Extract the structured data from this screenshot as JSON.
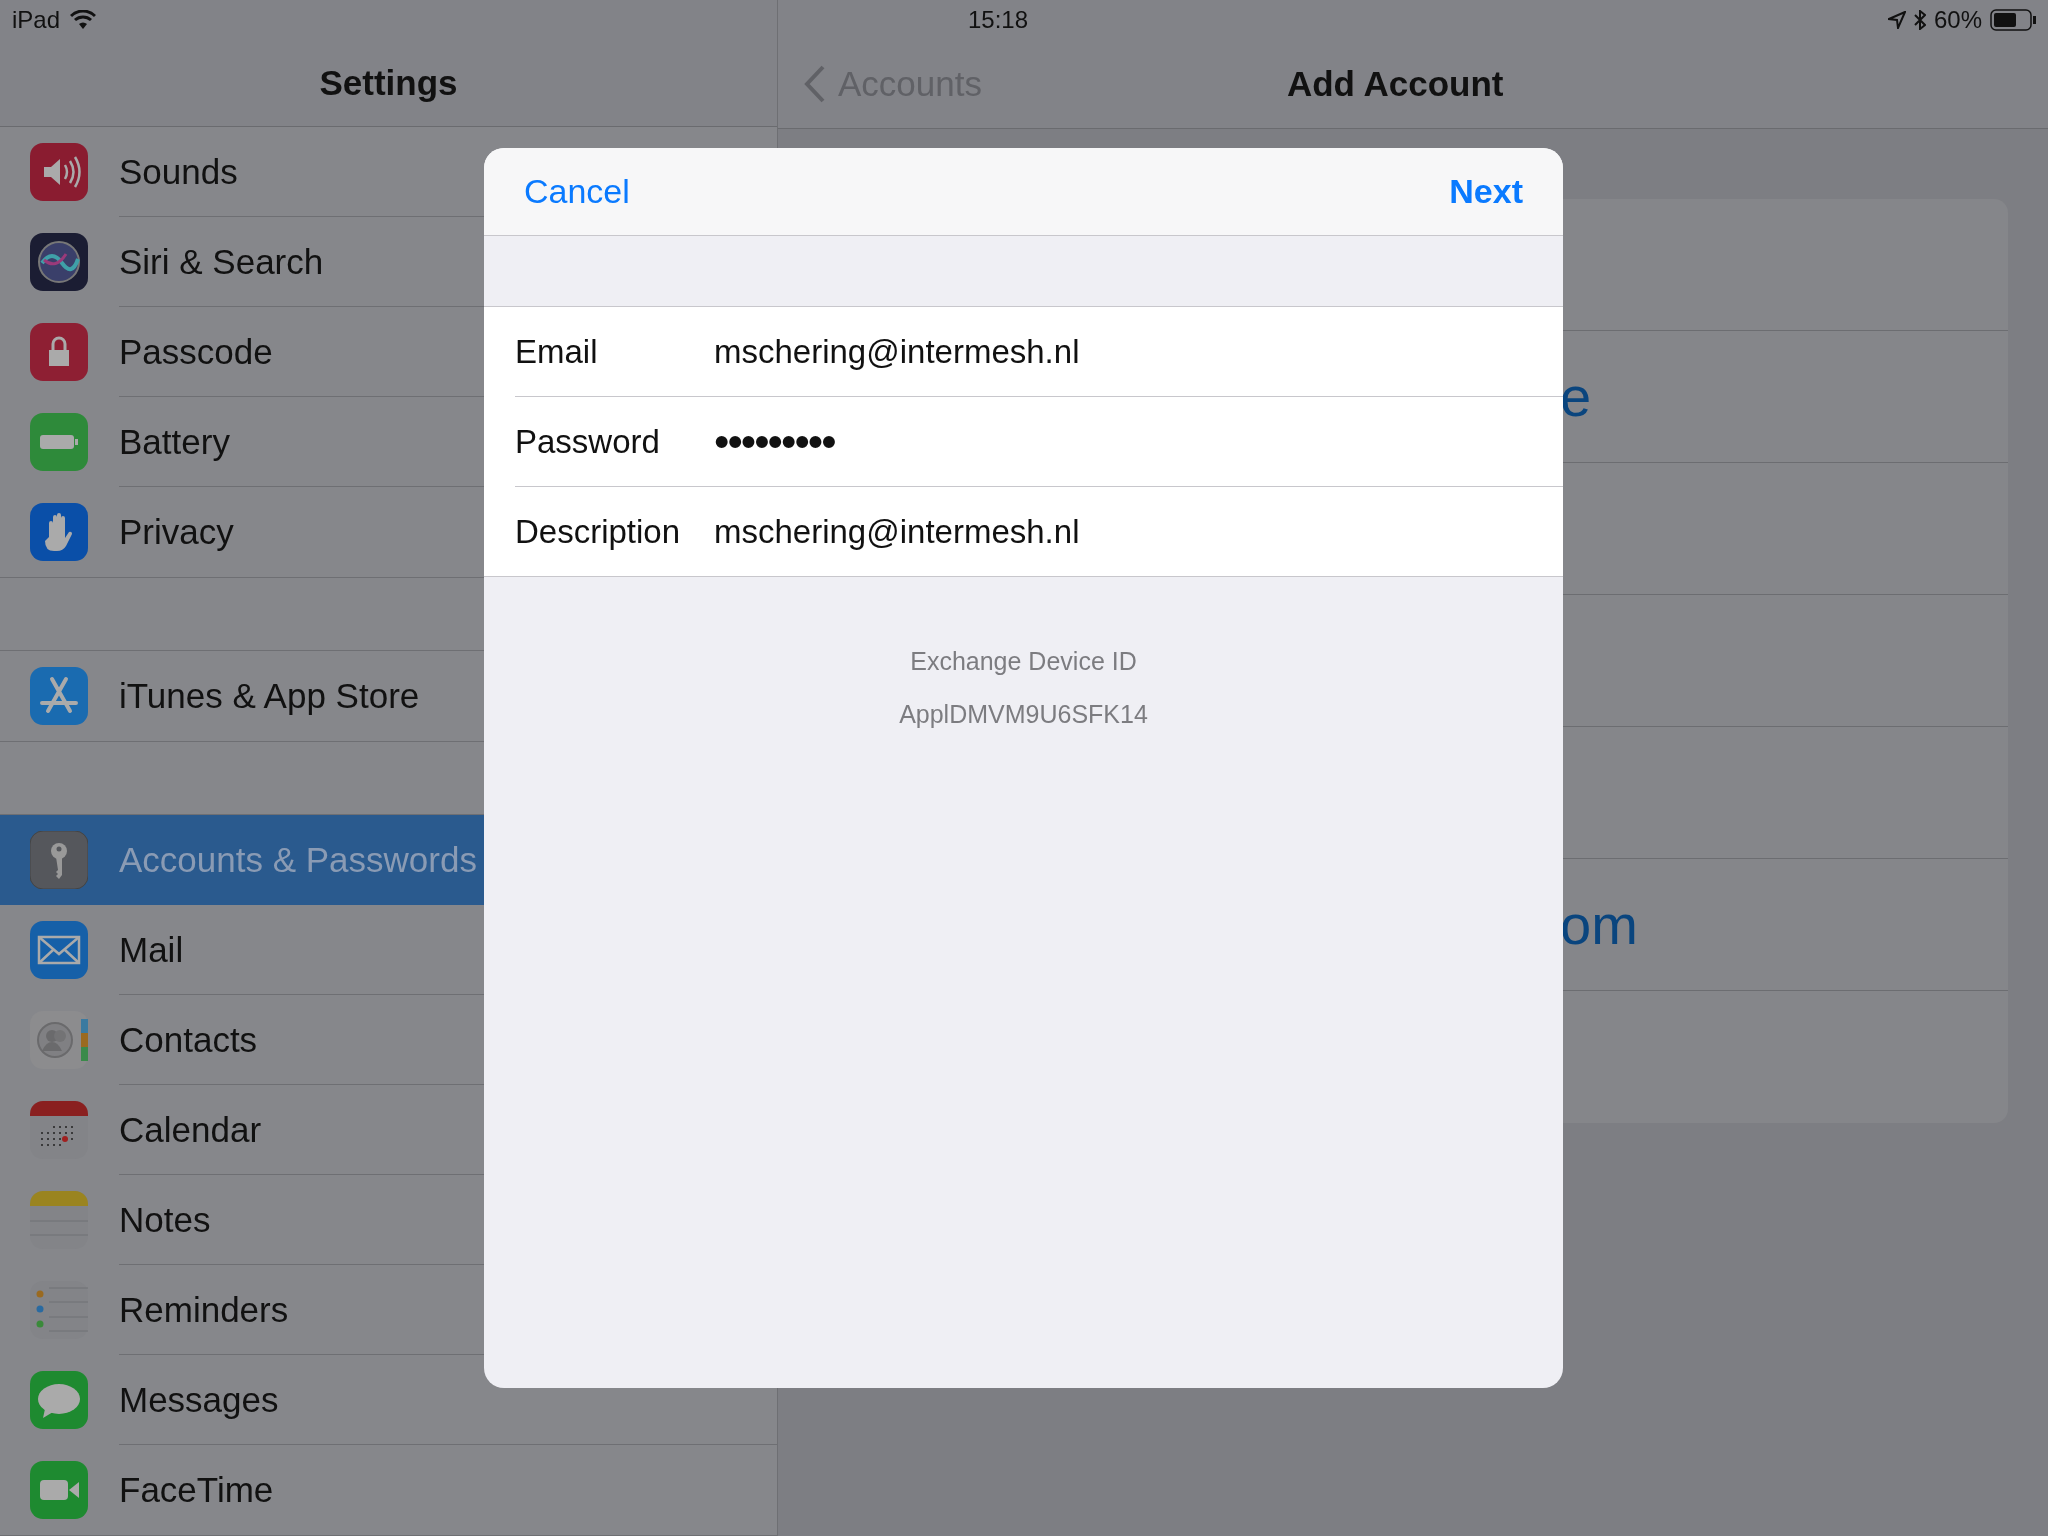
{
  "status_bar": {
    "device": "iPad",
    "time": "15:18",
    "battery_percent": "60%"
  },
  "sidebar": {
    "title": "Settings",
    "groups": [
      [
        {
          "label": "Sounds",
          "kind": "sounds",
          "selected": false
        },
        {
          "label": "Siri & Search",
          "kind": "siri",
          "selected": false
        },
        {
          "label": "Passcode",
          "kind": "passcode",
          "selected": false
        },
        {
          "label": "Battery",
          "kind": "battery",
          "selected": false
        },
        {
          "label": "Privacy",
          "kind": "privacy",
          "selected": false
        }
      ],
      [
        {
          "label": "iTunes & App Store",
          "kind": "appstore",
          "selected": false
        }
      ],
      [
        {
          "label": "Accounts & Passwords",
          "kind": "key",
          "selected": true
        },
        {
          "label": "Mail",
          "kind": "mail",
          "selected": false
        },
        {
          "label": "Contacts",
          "kind": "contacts",
          "selected": false
        },
        {
          "label": "Calendar",
          "kind": "calendar",
          "selected": false
        },
        {
          "label": "Notes",
          "kind": "notes",
          "selected": false
        },
        {
          "label": "Reminders",
          "kind": "reminders",
          "selected": false
        },
        {
          "label": "Messages",
          "kind": "messages",
          "selected": false
        },
        {
          "label": "FaceTime",
          "kind": "facetime",
          "selected": false
        }
      ]
    ]
  },
  "detail": {
    "back_label": "Accounts",
    "title": "Add Account",
    "provider_rows": [
      {
        "kind": "hidden"
      },
      {
        "kind": "text",
        "label": "e"
      },
      {
        "kind": "hidden"
      },
      {
        "kind": "hidden"
      },
      {
        "kind": "hidden"
      },
      {
        "kind": "text",
        "label": "om"
      },
      {
        "kind": "hidden"
      }
    ]
  },
  "dialog": {
    "cancel": "Cancel",
    "next": "Next",
    "fields": [
      {
        "label": "Email",
        "value": "mschering@intermesh.nl",
        "kind": "text"
      },
      {
        "label": "Password",
        "value": "•••••••••",
        "kind": "secure"
      },
      {
        "label": "Description",
        "value": "mschering@intermesh.nl",
        "kind": "text"
      }
    ],
    "footer": [
      "Exchange Device ID",
      "ApplDMVM9U6SFK14"
    ]
  }
}
